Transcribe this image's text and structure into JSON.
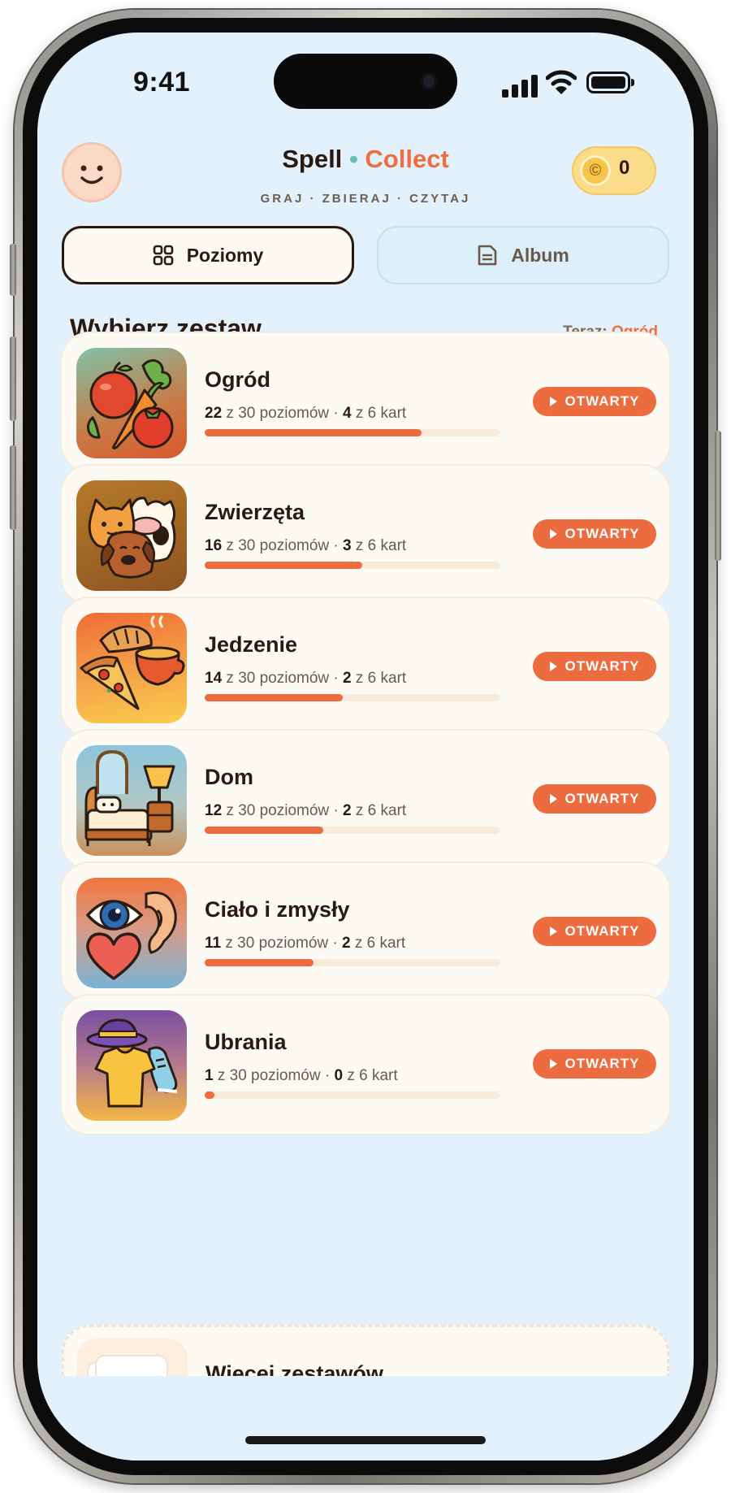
{
  "status": {
    "time": "9:41"
  },
  "header": {
    "brand_left": "Spell",
    "brand_dot": "•",
    "brand_right": "Collect",
    "tagline": "GRAJ · ZBIERAJ · CZYTAJ",
    "coins": "0",
    "coin_glyph": "©"
  },
  "tabs": [
    {
      "label": "Poziomy",
      "icon": "grid-icon",
      "selected": true
    },
    {
      "label": "Album",
      "icon": "album-icon",
      "selected": false
    }
  ],
  "section": {
    "title": "Wybierz zestaw",
    "current_label": "Teraz:",
    "current_value": "Ogród"
  },
  "sets": [
    {
      "name": "Ogród",
      "levels_done": "22",
      "levels_of": "z 30 poziomów ·",
      "cards_done": "4",
      "cards_of": "z 6 kart",
      "progress": 0.733,
      "status": "OTWARTY",
      "art": "garden"
    },
    {
      "name": "Zwierzęta",
      "levels_done": "16",
      "levels_of": "z 30 poziomów ·",
      "cards_done": "3",
      "cards_of": "z 6 kart",
      "progress": 0.533,
      "status": "OTWARTY",
      "art": "animals"
    },
    {
      "name": "Jedzenie",
      "levels_done": "14",
      "levels_of": "z 30 poziomów ·",
      "cards_done": "2",
      "cards_of": "z 6 kart",
      "progress": 0.467,
      "status": "OTWARTY",
      "art": "food"
    },
    {
      "name": "Dom",
      "levels_done": "12",
      "levels_of": "z 30 poziomów ·",
      "cards_done": "2",
      "cards_of": "z 6 kart",
      "progress": 0.4,
      "status": "OTWARTY",
      "art": "home"
    },
    {
      "name": "Ciało i zmysły",
      "levels_done": "11",
      "levels_of": "z 30 poziomów ·",
      "cards_done": "2",
      "cards_of": "z 6 kart",
      "progress": 0.367,
      "status": "OTWARTY",
      "art": "body"
    },
    {
      "name": "Ubrania",
      "levels_done": "1",
      "levels_of": "z 30 poziomów ·",
      "cards_done": "0",
      "cards_of": "z 6 kart",
      "progress": 0.033,
      "status": "OTWARTY",
      "art": "clothes"
    }
  ],
  "more": {
    "title": "Więcej zestawów",
    "icon": "lock-icon"
  },
  "colors": {
    "accent": "#ec6b3f",
    "background": "#e2f1fb",
    "card": "#fdfaf3",
    "text": "#2a1a10",
    "mint": "#63c3a6",
    "coin": "#fbdc8a"
  }
}
